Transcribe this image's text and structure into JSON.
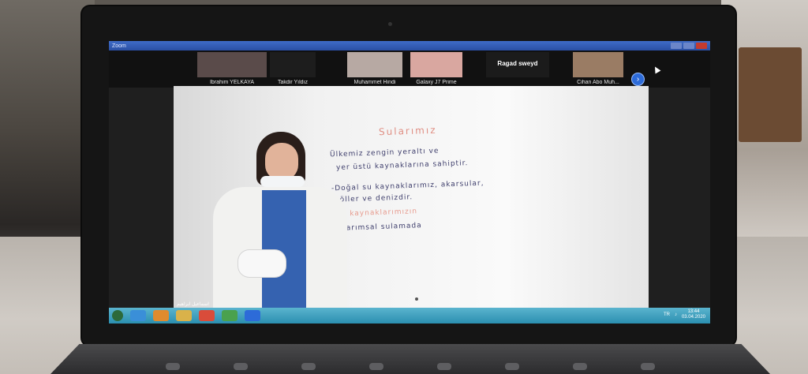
{
  "window": {
    "title": "Zoom"
  },
  "participants": [
    {
      "name": "İbrahim YELKAYA",
      "color": "#5a4b4a"
    },
    {
      "name": "Takdir Yıldız",
      "color": "#1d1d1d"
    },
    {
      "name": "Muhammet Hindi",
      "color": "#b7a9a3"
    },
    {
      "name": "Galaxy J7 Prime",
      "color": "#d9a7a0"
    },
    {
      "name": "Ragad sweyd",
      "color": "#1b1b1b"
    },
    {
      "name": "Cihan Abo Muh...",
      "color": "#9a7c64"
    }
  ],
  "next_icon": "chevron-right-icon",
  "main_video": {
    "speaker_caption": "اسماعيل ابراهيم",
    "board": {
      "title": "Sularımız",
      "lines": [
        "Ülkemiz zengin yeraltı ve",
        "yer üstü kaynaklarına sahiptir.",
        "-Doğal su kaynaklarımız, akarsular,",
        "göller ve denizdir.",
        "Su kaynaklarımızın",
        "-tarımsal sulamada"
      ]
    }
  },
  "taskbar": {
    "icons": [
      "start-icon",
      "ie-icon",
      "media-icon",
      "folder-icon",
      "chrome-icon",
      "app-icon",
      "zoom-icon"
    ],
    "language": "TR",
    "time": "13:44",
    "date": "03.04.2020"
  }
}
